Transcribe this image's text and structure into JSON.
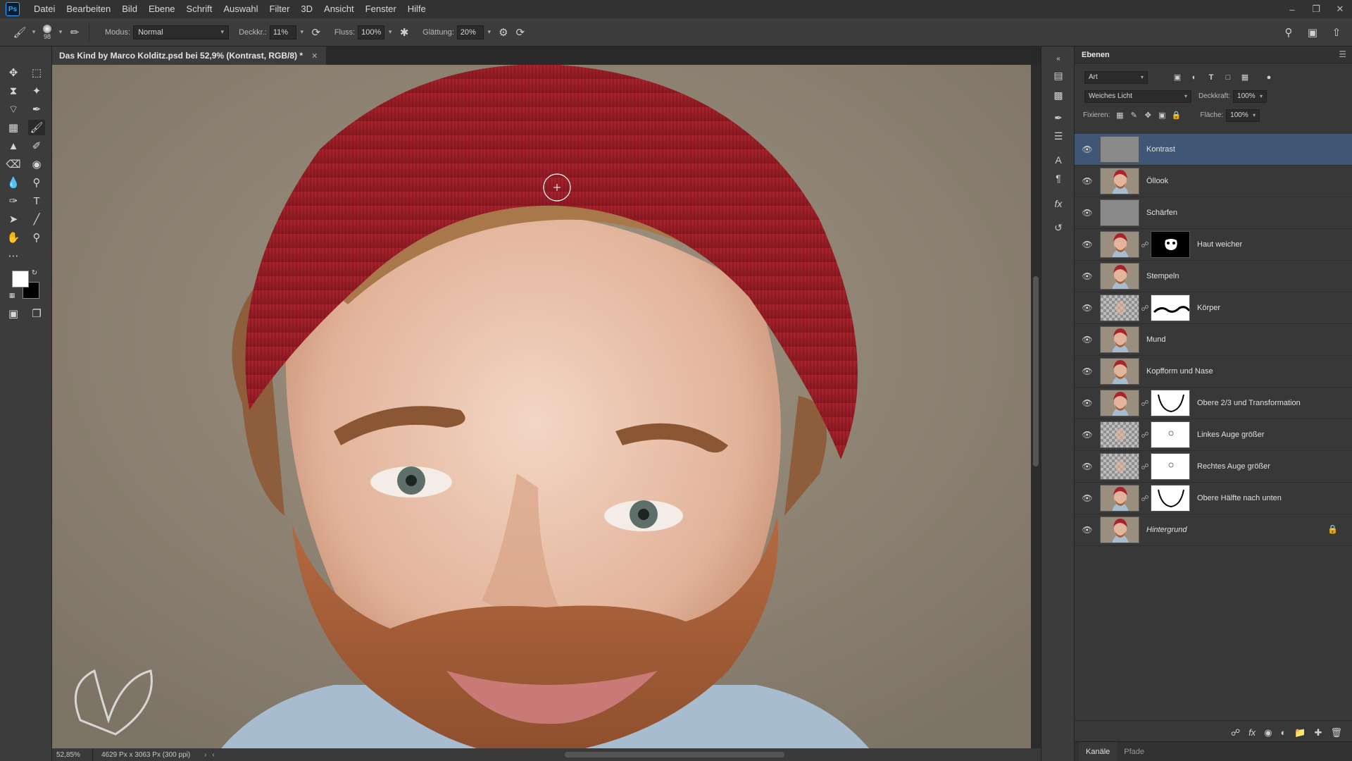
{
  "app": {
    "logo": "Ps"
  },
  "menu": [
    "Datei",
    "Bearbeiten",
    "Bild",
    "Ebene",
    "Schrift",
    "Auswahl",
    "Filter",
    "3D",
    "Ansicht",
    "Fenster",
    "Hilfe"
  ],
  "options": {
    "brush_size": "98",
    "mode_label": "Modus:",
    "mode_value": "Normal",
    "opacity_label": "Deckkr.:",
    "opacity_value": "11%",
    "flow_label": "Fluss:",
    "flow_value": "100%",
    "smoothing_label": "Glättung:",
    "smoothing_value": "20%"
  },
  "document": {
    "tab_title": "Das Kind by Marco Kolditz.psd bei 52,9% (Kontrast, RGB/8) *",
    "zoom": "52,85%",
    "info": "4629 Px x 3063 Px (300 ppi)"
  },
  "layers_panel": {
    "title": "Ebenen",
    "filter_kind": "Art",
    "blend_mode": "Weiches Licht",
    "opacity_label": "Deckkraft:",
    "opacity_value": "100%",
    "lock_label": "Fixieren:",
    "fill_label": "Fläche:",
    "fill_value": "100%",
    "layers": [
      {
        "name": "Kontrast",
        "thumb": "gray",
        "mask": "",
        "selected": true
      },
      {
        "name": "Öllook",
        "thumb": "face",
        "mask": ""
      },
      {
        "name": "Schärfen",
        "thumb": "gray",
        "mask": ""
      },
      {
        "name": "Haut weicher",
        "thumb": "face",
        "mask": "black"
      },
      {
        "name": "Stempeln",
        "thumb": "face",
        "mask": ""
      },
      {
        "name": "Körper",
        "thumb": "checker",
        "mask": "white-line"
      },
      {
        "name": "Mund",
        "thumb": "face",
        "mask": ""
      },
      {
        "name": "Kopfform und Nase",
        "thumb": "face",
        "mask": ""
      },
      {
        "name": "Obere 2/3 und Transformation",
        "thumb": "face",
        "mask": "white-v"
      },
      {
        "name": "Linkes Auge größer",
        "thumb": "checker",
        "mask": "white-dot"
      },
      {
        "name": "Rechtes Auge größer",
        "thumb": "checker",
        "mask": "white-dot"
      },
      {
        "name": "Obere Hälfte nach unten",
        "thumb": "face",
        "mask": "white-v"
      },
      {
        "name": "Hintergrund",
        "thumb": "face",
        "mask": "",
        "italic": true,
        "locked": true
      }
    ]
  },
  "bottom_tabs": [
    "Kanäle",
    "Pfade"
  ],
  "colors": {
    "selection": "#3f5677",
    "panel": "#383838",
    "accent": "#31a8ff"
  }
}
